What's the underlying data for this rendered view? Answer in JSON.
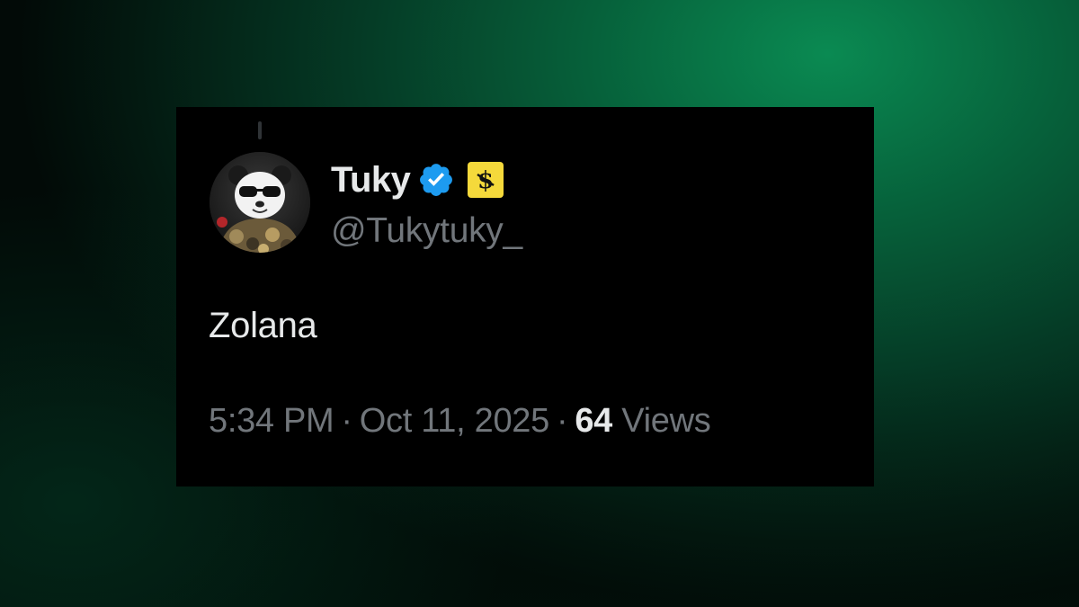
{
  "tweet": {
    "author": {
      "display_name": "Tuky",
      "handle": "@Tukytuky_",
      "verified": true,
      "verified_badge_color": "#1d9bf0",
      "affiliate_badge_color": "#f5d93b",
      "affiliate_badge_glyph": "$"
    },
    "text": "Zolana",
    "meta": {
      "time": "5:34 PM",
      "separator": "·",
      "date": "Oct 11, 2025",
      "views_count": "64",
      "views_label": "Views"
    }
  },
  "colors": {
    "card_background": "#000000",
    "primary_text": "#e7e9ea",
    "secondary_text": "#71767b",
    "page_background": "#06603a"
  },
  "icons": {
    "avatar": "panda-avatar",
    "verified": "verified-badge-icon",
    "affiliate": "affiliate-badge-icon"
  }
}
